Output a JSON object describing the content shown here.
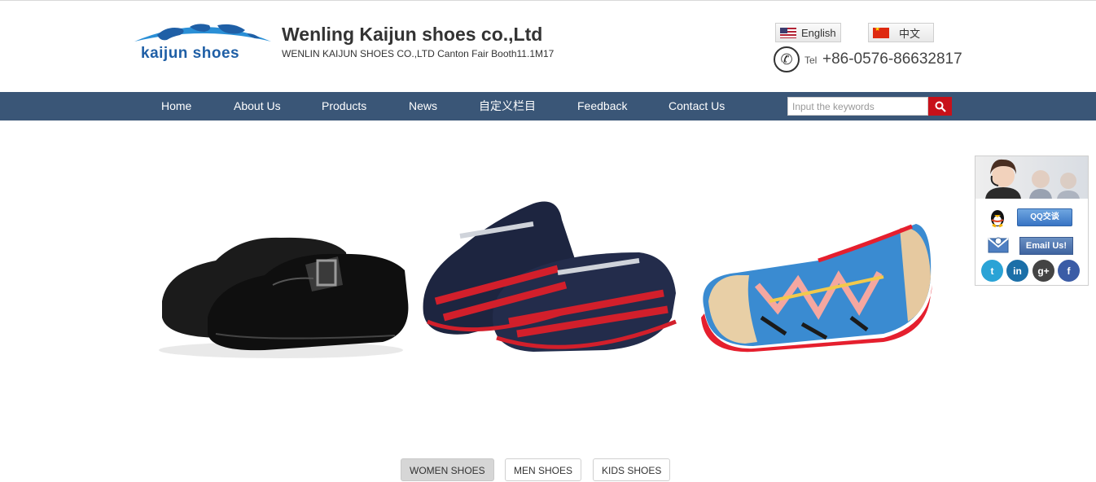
{
  "header": {
    "logo_text": "kaijun shoes",
    "company_title": "Wenling Kaijun shoes co.,Ltd",
    "company_subtitle": "WENLIN KAIJUN SHOES CO.,LTD Canton Fair Booth11.1M17",
    "lang_english": "English",
    "lang_chinese": "中文",
    "tel_label": "Tel",
    "tel_number": "+86-0576-86632817"
  },
  "nav": {
    "items": [
      "Home",
      "About Us",
      "Products",
      "News",
      "自定义栏目",
      "Feedback",
      "Contact Us"
    ],
    "search_placeholder": "Input the keywords"
  },
  "tabs": [
    "WOMEN SHOES",
    "MEN SHOES",
    "KIDS SHOES"
  ],
  "customer_service": {
    "qq_label": "QQ交谈",
    "email_label": "Email Us!",
    "social_icons": [
      "twitter-icon",
      "linkedin-icon",
      "google-plus-icon",
      "facebook-icon"
    ]
  },
  "colors": {
    "nav_bg": "#3a5677",
    "search_button": "#c8111a",
    "logo_blue": "#1f5fa6"
  }
}
